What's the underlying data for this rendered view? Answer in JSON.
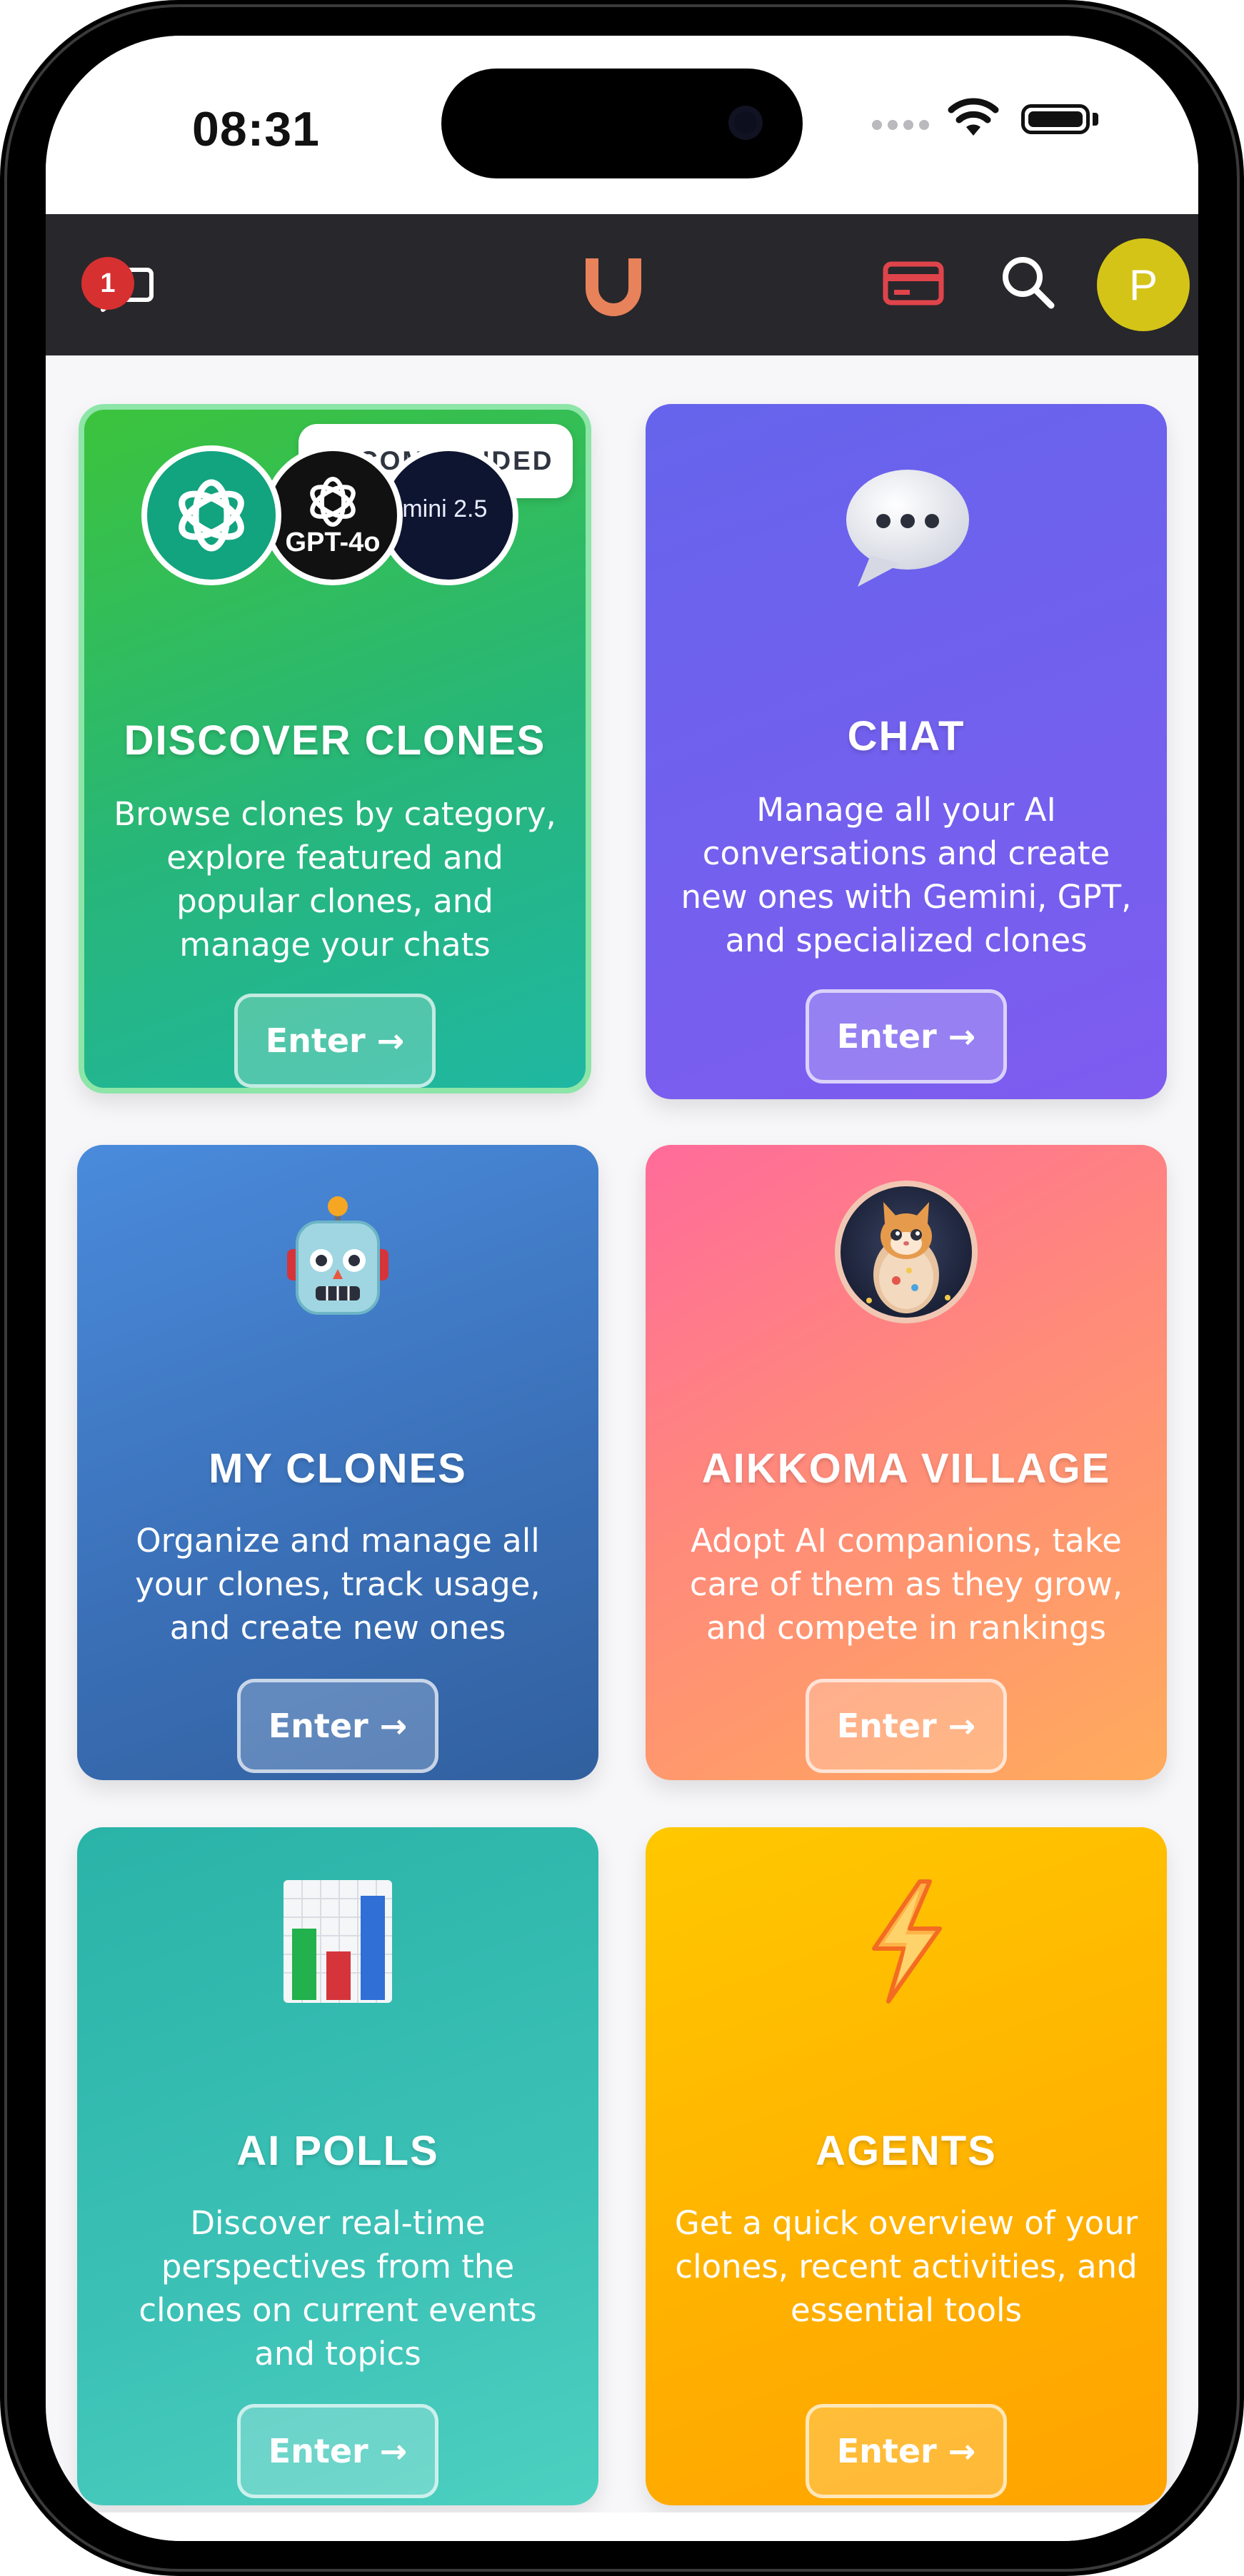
{
  "status_bar": {
    "time": "08:31"
  },
  "header": {
    "notification_count": "1",
    "logo_letter": "U",
    "avatar_initial": "P",
    "colors": {
      "logo": "#e8825a",
      "card_icon": "#e0444b",
      "avatar": "#d4c417",
      "bar": "#28272b"
    }
  },
  "cards": {
    "discover": {
      "badge": "RECOMMENDED",
      "title": "DISCOVER CLONES",
      "description": "Browse clones by category, explore featured and popular clones, and manage your chats",
      "button": "Enter →",
      "logos": {
        "gpt": "GPT-4o",
        "gemini": "Gemini 2.5"
      }
    },
    "chat": {
      "icon": "speech-bubble-icon",
      "title": "CHAT",
      "description": "Manage all your AI conversations and create new ones with Gemini, GPT, and specialized clones",
      "button": "Enter →"
    },
    "my_clones": {
      "icon": "robot-icon",
      "title": "MY CLONES",
      "description": "Organize and manage all your clones, track usage, and create new ones",
      "button": "Enter →"
    },
    "village": {
      "icon": "kitten-egg-avatar",
      "title": "AIKKOMA VILLAGE",
      "description": "Adopt AI companions, take care of them as they grow, and compete in rankings",
      "button": "Enter →"
    },
    "polls": {
      "icon": "bar-chart-icon",
      "title": "AI POLLS",
      "description": "Discover real-time perspectives from the clones on current events and topics",
      "button": "Enter →"
    },
    "agents": {
      "icon": "lightning-icon",
      "title": "AGENTS",
      "description": "Get a quick overview of your clones, recent activities, and essential tools",
      "button": "Enter →"
    }
  }
}
